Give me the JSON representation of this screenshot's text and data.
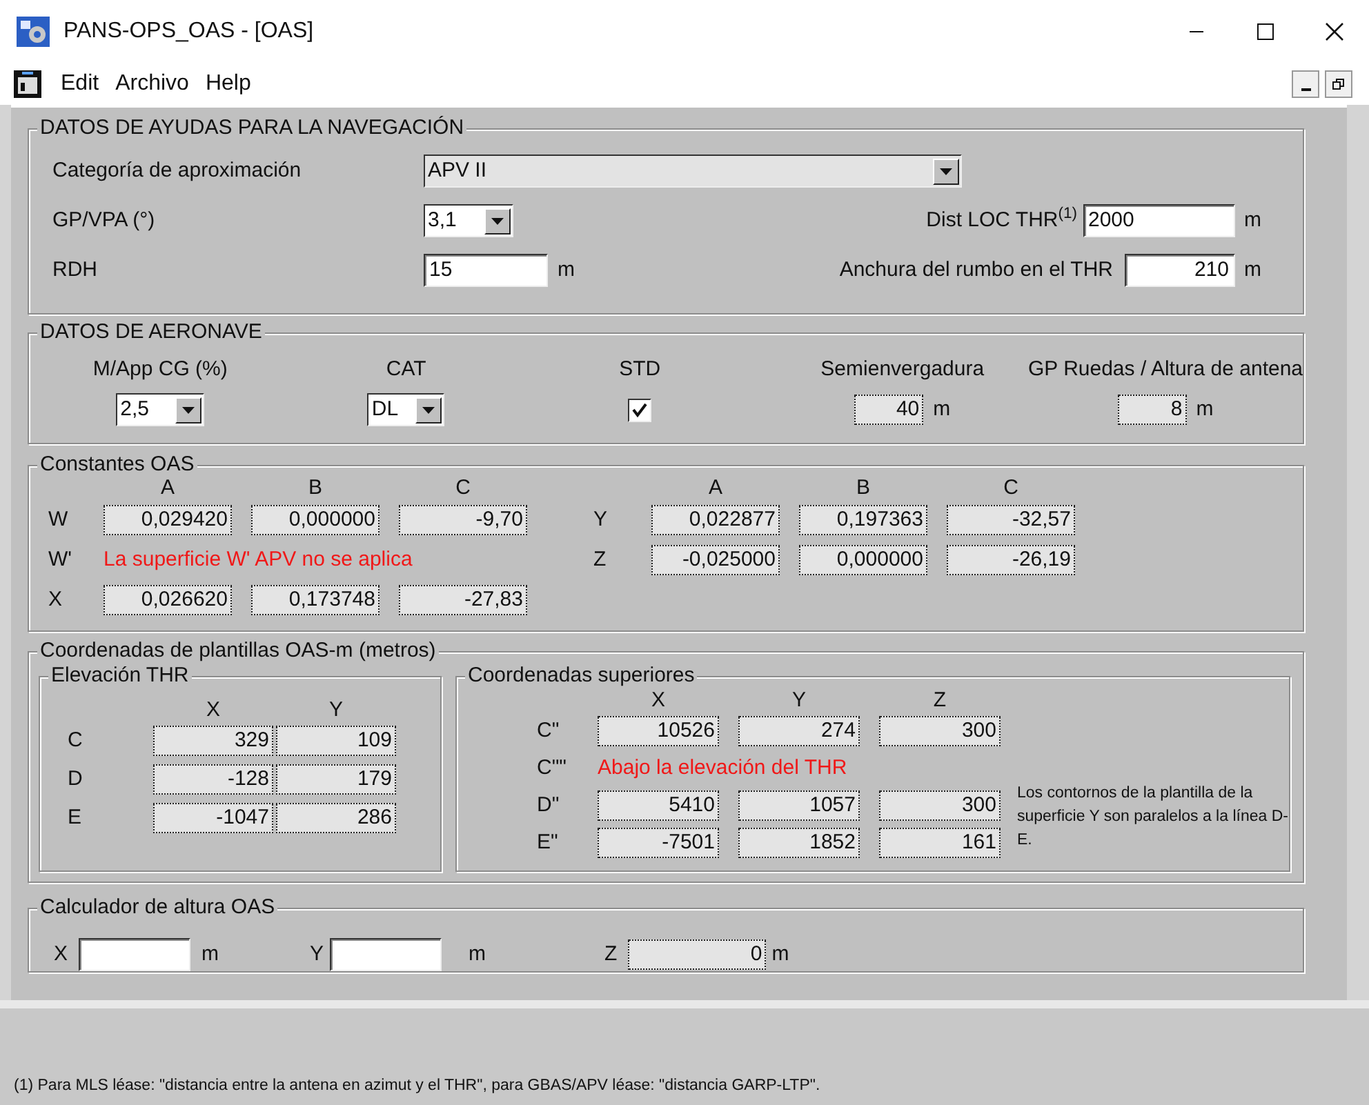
{
  "window": {
    "title": "PANS-OPS_OAS - [OAS]"
  },
  "menu": [
    "Edit",
    "Archivo",
    "Help"
  ],
  "nav_aids": {
    "title": "DATOS DE AYUDAS PARA LA NAVEGACIÓN",
    "approach_category": {
      "label": "Categoría de aproximación",
      "value": "APV II"
    },
    "gp_vpa": {
      "label": "GP/VPA (°)",
      "value": "3,1"
    },
    "rdh": {
      "label": "RDH",
      "value": "15",
      "unit": "m"
    },
    "dist_loc_thr": {
      "label": "Dist LOC THR$^{(1)}$",
      "value": "2000",
      "unit": "m"
    },
    "course_width": {
      "label": "Anchura del rumbo en el THR",
      "value": "210",
      "unit": "m"
    }
  },
  "aircraft": {
    "title": "DATOS DE AERONAVE",
    "cg": {
      "label": "M/App CG (%)",
      "value": "2,5"
    },
    "cat": {
      "label": "CAT",
      "value": "DL"
    },
    "std": {
      "label": "STD",
      "checked": true
    },
    "semispan": {
      "label": "Semienvergadura",
      "value": "40",
      "unit": "m"
    },
    "gp_wheels": {
      "label": "GP Ruedas / Altura de antena",
      "value": "8",
      "unit": "m"
    }
  },
  "constants": {
    "title": "Constantes OAS",
    "left_columns": [
      "A",
      "B",
      "C"
    ],
    "right_columns": [
      "A",
      "B",
      "C"
    ],
    "left_rows": [
      {
        "label": "W",
        "kind": "values",
        "values": [
          "0,029420",
          "0,000000",
          "-9,70"
        ]
      },
      {
        "label": "W'",
        "kind": "message",
        "message": "La superficie W' APV no se aplica"
      },
      {
        "label": "X",
        "kind": "values",
        "values": [
          "0,026620",
          "0,173748",
          "-27,83"
        ]
      }
    ],
    "right_rows": [
      {
        "label": "Y",
        "kind": "values",
        "values": [
          "0,022877",
          "0,197363",
          "-32,57"
        ]
      },
      {
        "label": "Z",
        "kind": "values",
        "values": [
          "-0,025000",
          "0,000000",
          "-26,19"
        ]
      }
    ]
  },
  "templates": {
    "title": "Coordenadas de plantillas OAS-m (metros)",
    "threshold": {
      "title": "Elevación THR",
      "columns": [
        "X",
        "Y"
      ],
      "rows": [
        {
          "label": "C",
          "values": [
            "329",
            "109"
          ]
        },
        {
          "label": "D",
          "values": [
            "-128",
            "179"
          ]
        },
        {
          "label": "E",
          "values": [
            "-1047",
            "286"
          ]
        }
      ]
    },
    "upper": {
      "title": "Coordenadas superiores",
      "columns": [
        "X",
        "Y",
        "Z"
      ],
      "rows": [
        {
          "label": "C\"",
          "kind": "values",
          "values": [
            "10526",
            "274",
            "300"
          ]
        },
        {
          "label": "C\"\"",
          "kind": "message",
          "message": "Abajo la elevación del THR"
        },
        {
          "label": "D\"",
          "kind": "values",
          "values": [
            "5410",
            "1057",
            "300"
          ]
        },
        {
          "label": "E\"",
          "kind": "values",
          "values": [
            "-7501",
            "1852",
            "161"
          ]
        }
      ],
      "note": "Los contornos de la plantilla de la superficie Y son paralelos a la línea D-E."
    }
  },
  "calculator": {
    "title": "Calculador de altura OAS",
    "x": {
      "label": "X",
      "unit": "m"
    },
    "y": {
      "label": "Y",
      "unit": "m"
    },
    "z": {
      "label": "Z",
      "value": "0",
      "unit": "m"
    }
  },
  "footnote": "(1) Para MLS léase: \"distancia entre la antena en azimut y el THR\", para GBAS/APV léase: \"distancia GARP-LTP\"."
}
